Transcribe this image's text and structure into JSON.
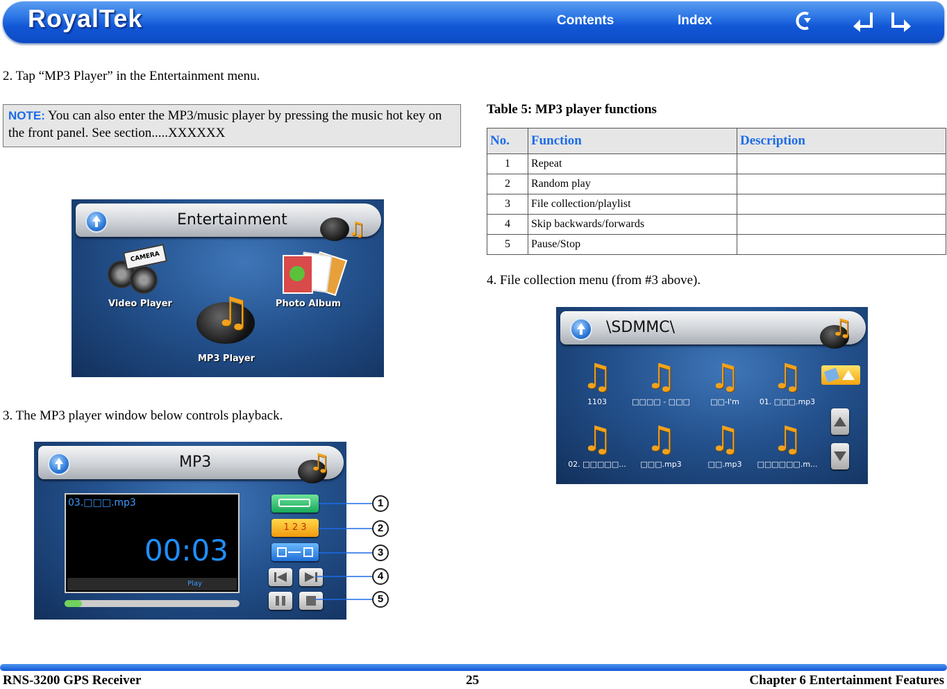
{
  "header": {
    "logo": "RoyalTek",
    "contents": "Contents",
    "index": "Index",
    "icons": [
      "back-icon",
      "previous-page-icon",
      "next-page-icon"
    ]
  },
  "left": {
    "step2": "2.    Tap “MP3 Player” in the Entertainment menu.",
    "note_label": "NOTE:",
    "note_text": " You can also enter the MP3/music player by pressing the music hot key on the front panel. See section.....XXXXXX",
    "step3": "3.    The MP3 player window below controls playback."
  },
  "entertainment": {
    "title": "Entertainment",
    "video": "Video Player",
    "photo": "Photo Album",
    "mp3": "MP3 Player",
    "camera": "CAMERA"
  },
  "mp3": {
    "title": "MP3",
    "track": "03.□□□.mp3",
    "time": "00:03",
    "state": "Play",
    "progress": 0.1,
    "callouts": [
      "1",
      "2",
      "3",
      "4",
      "5"
    ],
    "random_label": "1 2 3"
  },
  "table": {
    "caption": "Table 5: MP3 player functions",
    "headers": [
      "No.",
      "Function",
      "Description"
    ],
    "rows": [
      {
        "no": "1",
        "fn": "Repeat",
        "desc": ""
      },
      {
        "no": "2",
        "fn": "Random play",
        "desc": ""
      },
      {
        "no": "3",
        "fn": "File collection/playlist",
        "desc": ""
      },
      {
        "no": "4",
        "fn": "Skip backwards/forwards",
        "desc": ""
      },
      {
        "no": "5",
        "fn": "Pause/Stop",
        "desc": ""
      }
    ]
  },
  "right": {
    "step4": "4.    File collection menu (from #3 above)."
  },
  "files": {
    "title": "\\SDMMC\\",
    "items": [
      "1103",
      "□□□□ - □□□",
      "□□-I'm",
      "01. □□□.mp3",
      "02. □□□□□...",
      "□□□.mp3",
      "□□.mp3",
      "□□□□□□.m..."
    ]
  },
  "footer": {
    "left": "RNS-3200 GPS Receiver",
    "page": "25",
    "right": "Chapter 6 Entertainment Features"
  },
  "colors": {
    "accent": "#1c6ce8",
    "header": "#1257d6"
  }
}
